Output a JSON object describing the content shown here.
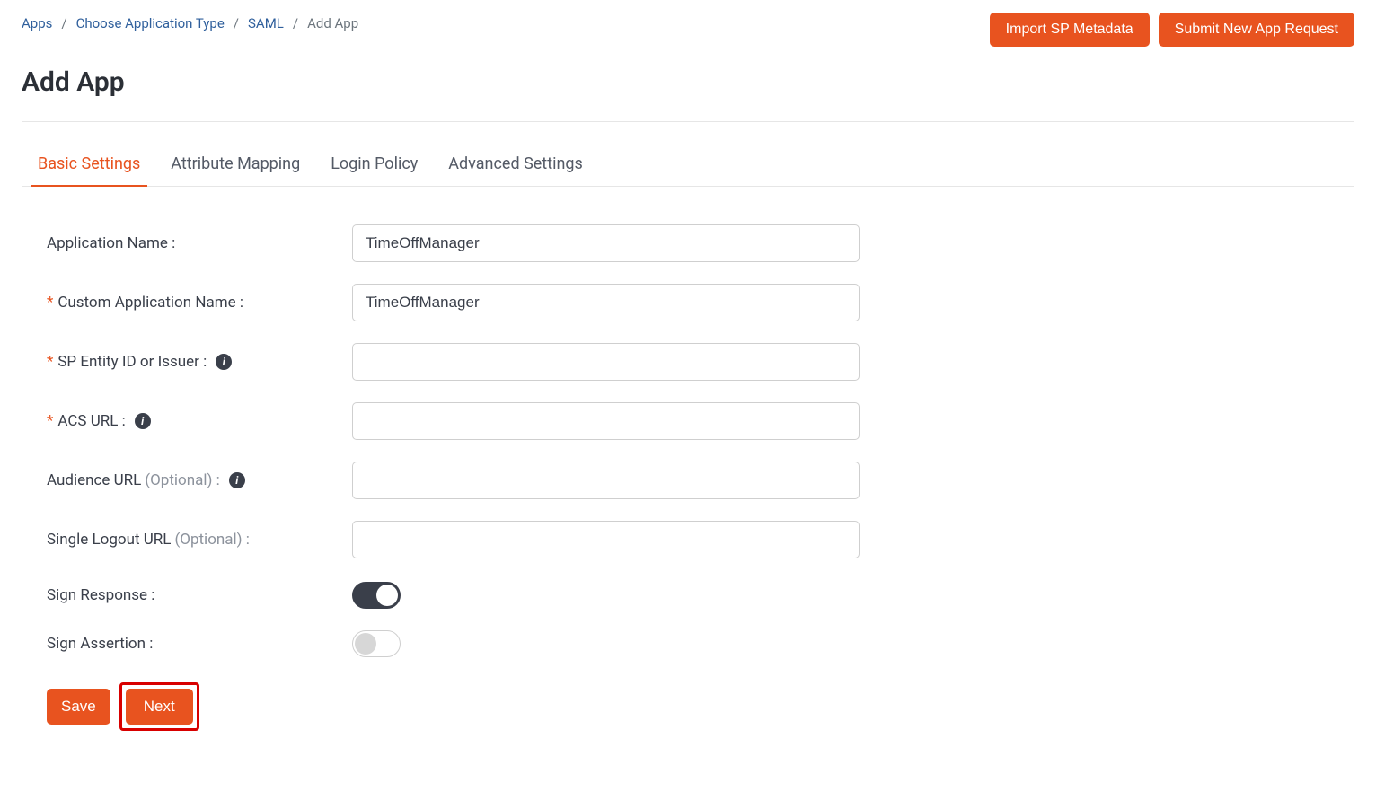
{
  "breadcrumb": {
    "items": [
      {
        "label": "Apps",
        "link": true
      },
      {
        "label": "Choose Application Type",
        "link": true
      },
      {
        "label": "SAML",
        "link": true
      },
      {
        "label": "Add App",
        "link": false
      }
    ],
    "sep": "/"
  },
  "top_actions": {
    "import_metadata": "Import SP Metadata",
    "submit_request": "Submit New App Request"
  },
  "page_title": "Add App",
  "tabs": {
    "basic": "Basic Settings",
    "attribute": "Attribute Mapping",
    "login": "Login Policy",
    "advanced": "Advanced Settings"
  },
  "form": {
    "app_name_label": "Application Name :",
    "app_name_value": "TimeOffManager",
    "custom_app_label": "Custom Application Name :",
    "custom_app_value": "TimeOffManager",
    "sp_entity_label": "SP Entity ID or Issuer :",
    "sp_entity_value": "",
    "acs_label": "ACS URL :",
    "acs_value": "",
    "audience_label": "Audience URL",
    "audience_optional": "(Optional) :",
    "audience_value": "",
    "slo_label": "Single Logout URL",
    "slo_optional": "(Optional) :",
    "slo_value": "",
    "sign_response_label": "Sign Response :",
    "sign_response_on": true,
    "sign_assertion_label": "Sign Assertion :",
    "sign_assertion_on": false
  },
  "bottom_actions": {
    "save": "Save",
    "next": "Next"
  }
}
